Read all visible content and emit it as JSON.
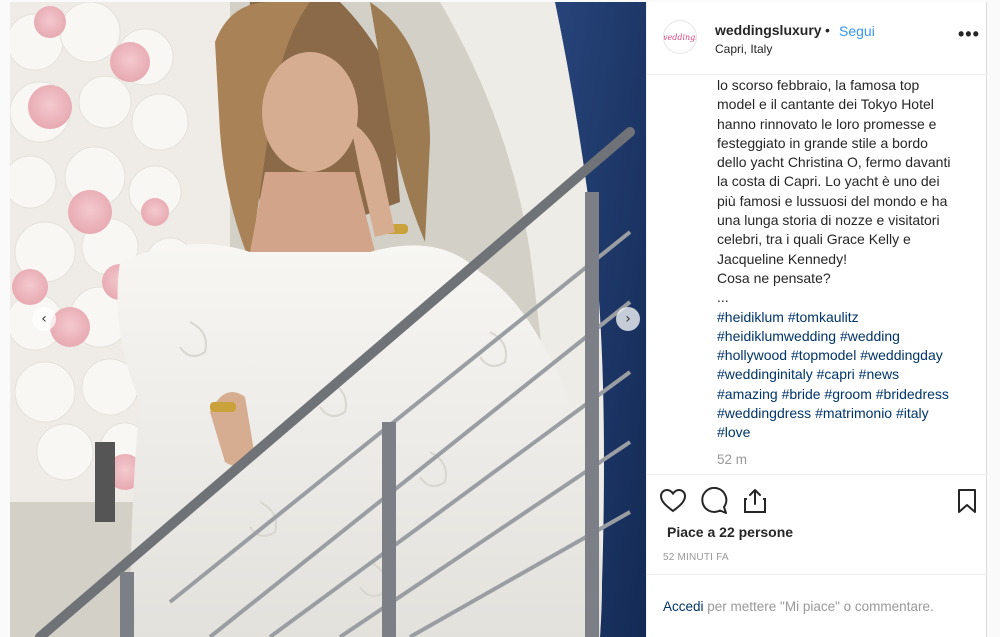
{
  "post": {
    "username": "weddingsluxury",
    "separator": "•",
    "follow_label": "Segui",
    "location": "Capri, Italy",
    "more_label": "•••",
    "avatar_text": "weddings"
  },
  "caption": {
    "lines": [
      "lo scorso febbraio, la famosa top",
      "model e il cantante dei Tokyo Hotel",
      "hanno rinnovato le loro promesse e",
      "festeggiato in grande stile a bordo",
      "dello yacht Christina O, fermo davanti",
      "la costa di Capri. Lo yacht è uno dei",
      "più famosi e lussuosi del mondo e ha",
      "una lunga storia di nozze e visitatori",
      "celebri, tra i quali Grace Kelly e",
      "Jacqueline Kennedy!",
      "Cosa ne pensate?",
      "..."
    ],
    "hashtag_lines": [
      [
        "#heidiklum",
        "#tomkaulitz"
      ],
      [
        "#heidiklumwedding",
        "#wedding"
      ],
      [
        "#hollywood",
        "#topmodel",
        "#weddingday"
      ],
      [
        "#weddinginitaly",
        "#capri",
        "#news"
      ],
      [
        "#amazing",
        "#bride",
        "#groom",
        "#bridedress"
      ],
      [
        "#weddingdress",
        "#matrimonio",
        "#italy"
      ],
      [
        "#love"
      ]
    ],
    "time": "52 m"
  },
  "stats": {
    "likes": "Piace a 22 persone",
    "posted": "52 MINUTI FA"
  },
  "footer": {
    "login_link": "Accedi",
    "login_text": " per mettere \"Mi piace\" o commentare."
  },
  "carousel": {
    "prev_icon": "chevron-left-icon",
    "next_icon": "chevron-right-icon"
  },
  "colors": {
    "link_blue": "#3897f0",
    "hashtag": "#003569",
    "muted": "#999999",
    "brand_pink": "#d6477f"
  }
}
